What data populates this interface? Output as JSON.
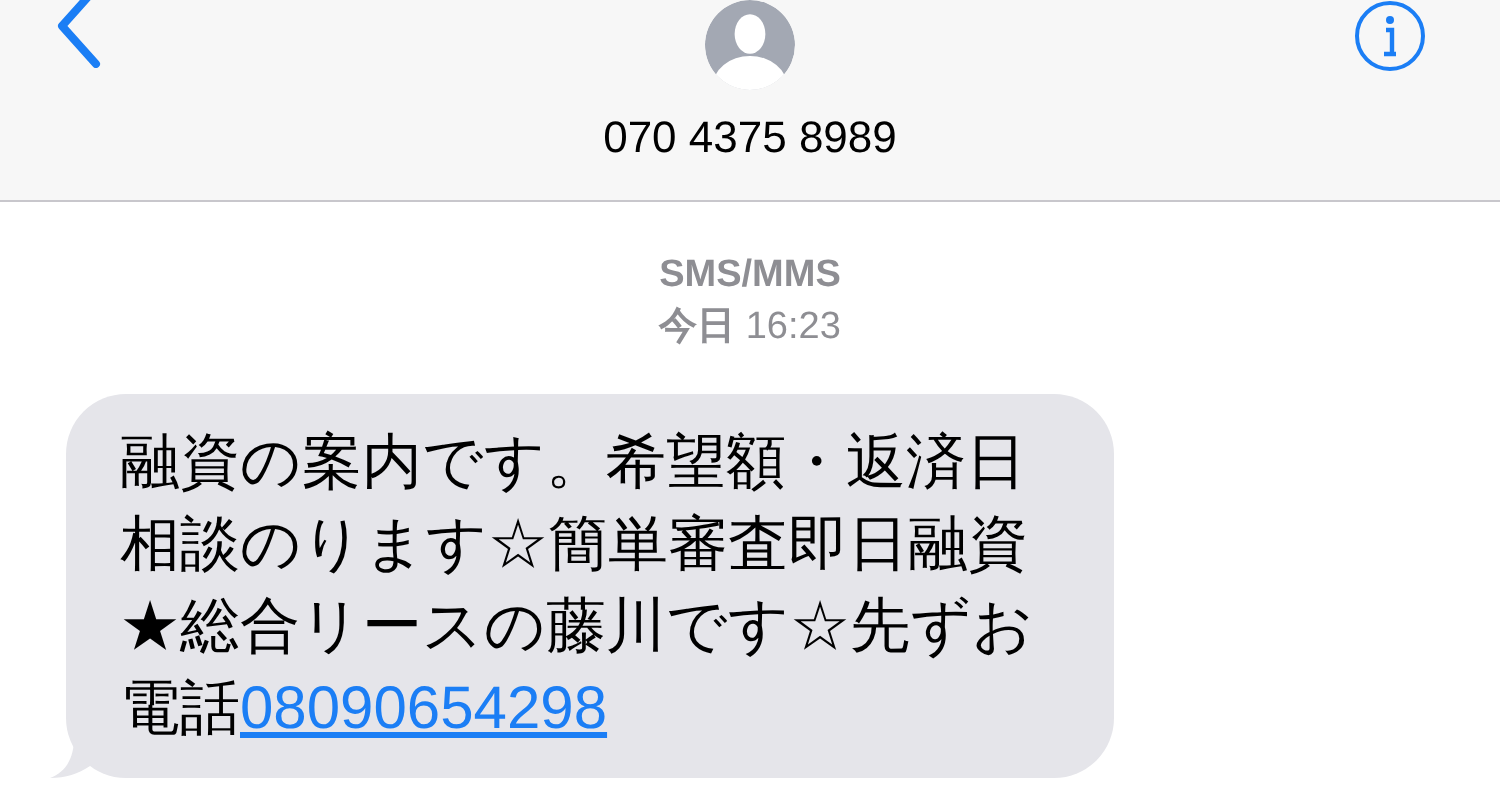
{
  "header": {
    "contact": "070 4375 8989"
  },
  "thread": {
    "service": "SMS/MMS",
    "day": "今日",
    "time": "16:23"
  },
  "messages": [
    {
      "kind": "received",
      "text": "融資の案内です。希望額・返済日相談のります☆簡単審査即日融資★総合リースの藤川です☆先ずお電話",
      "link": "08090654298"
    }
  ]
}
